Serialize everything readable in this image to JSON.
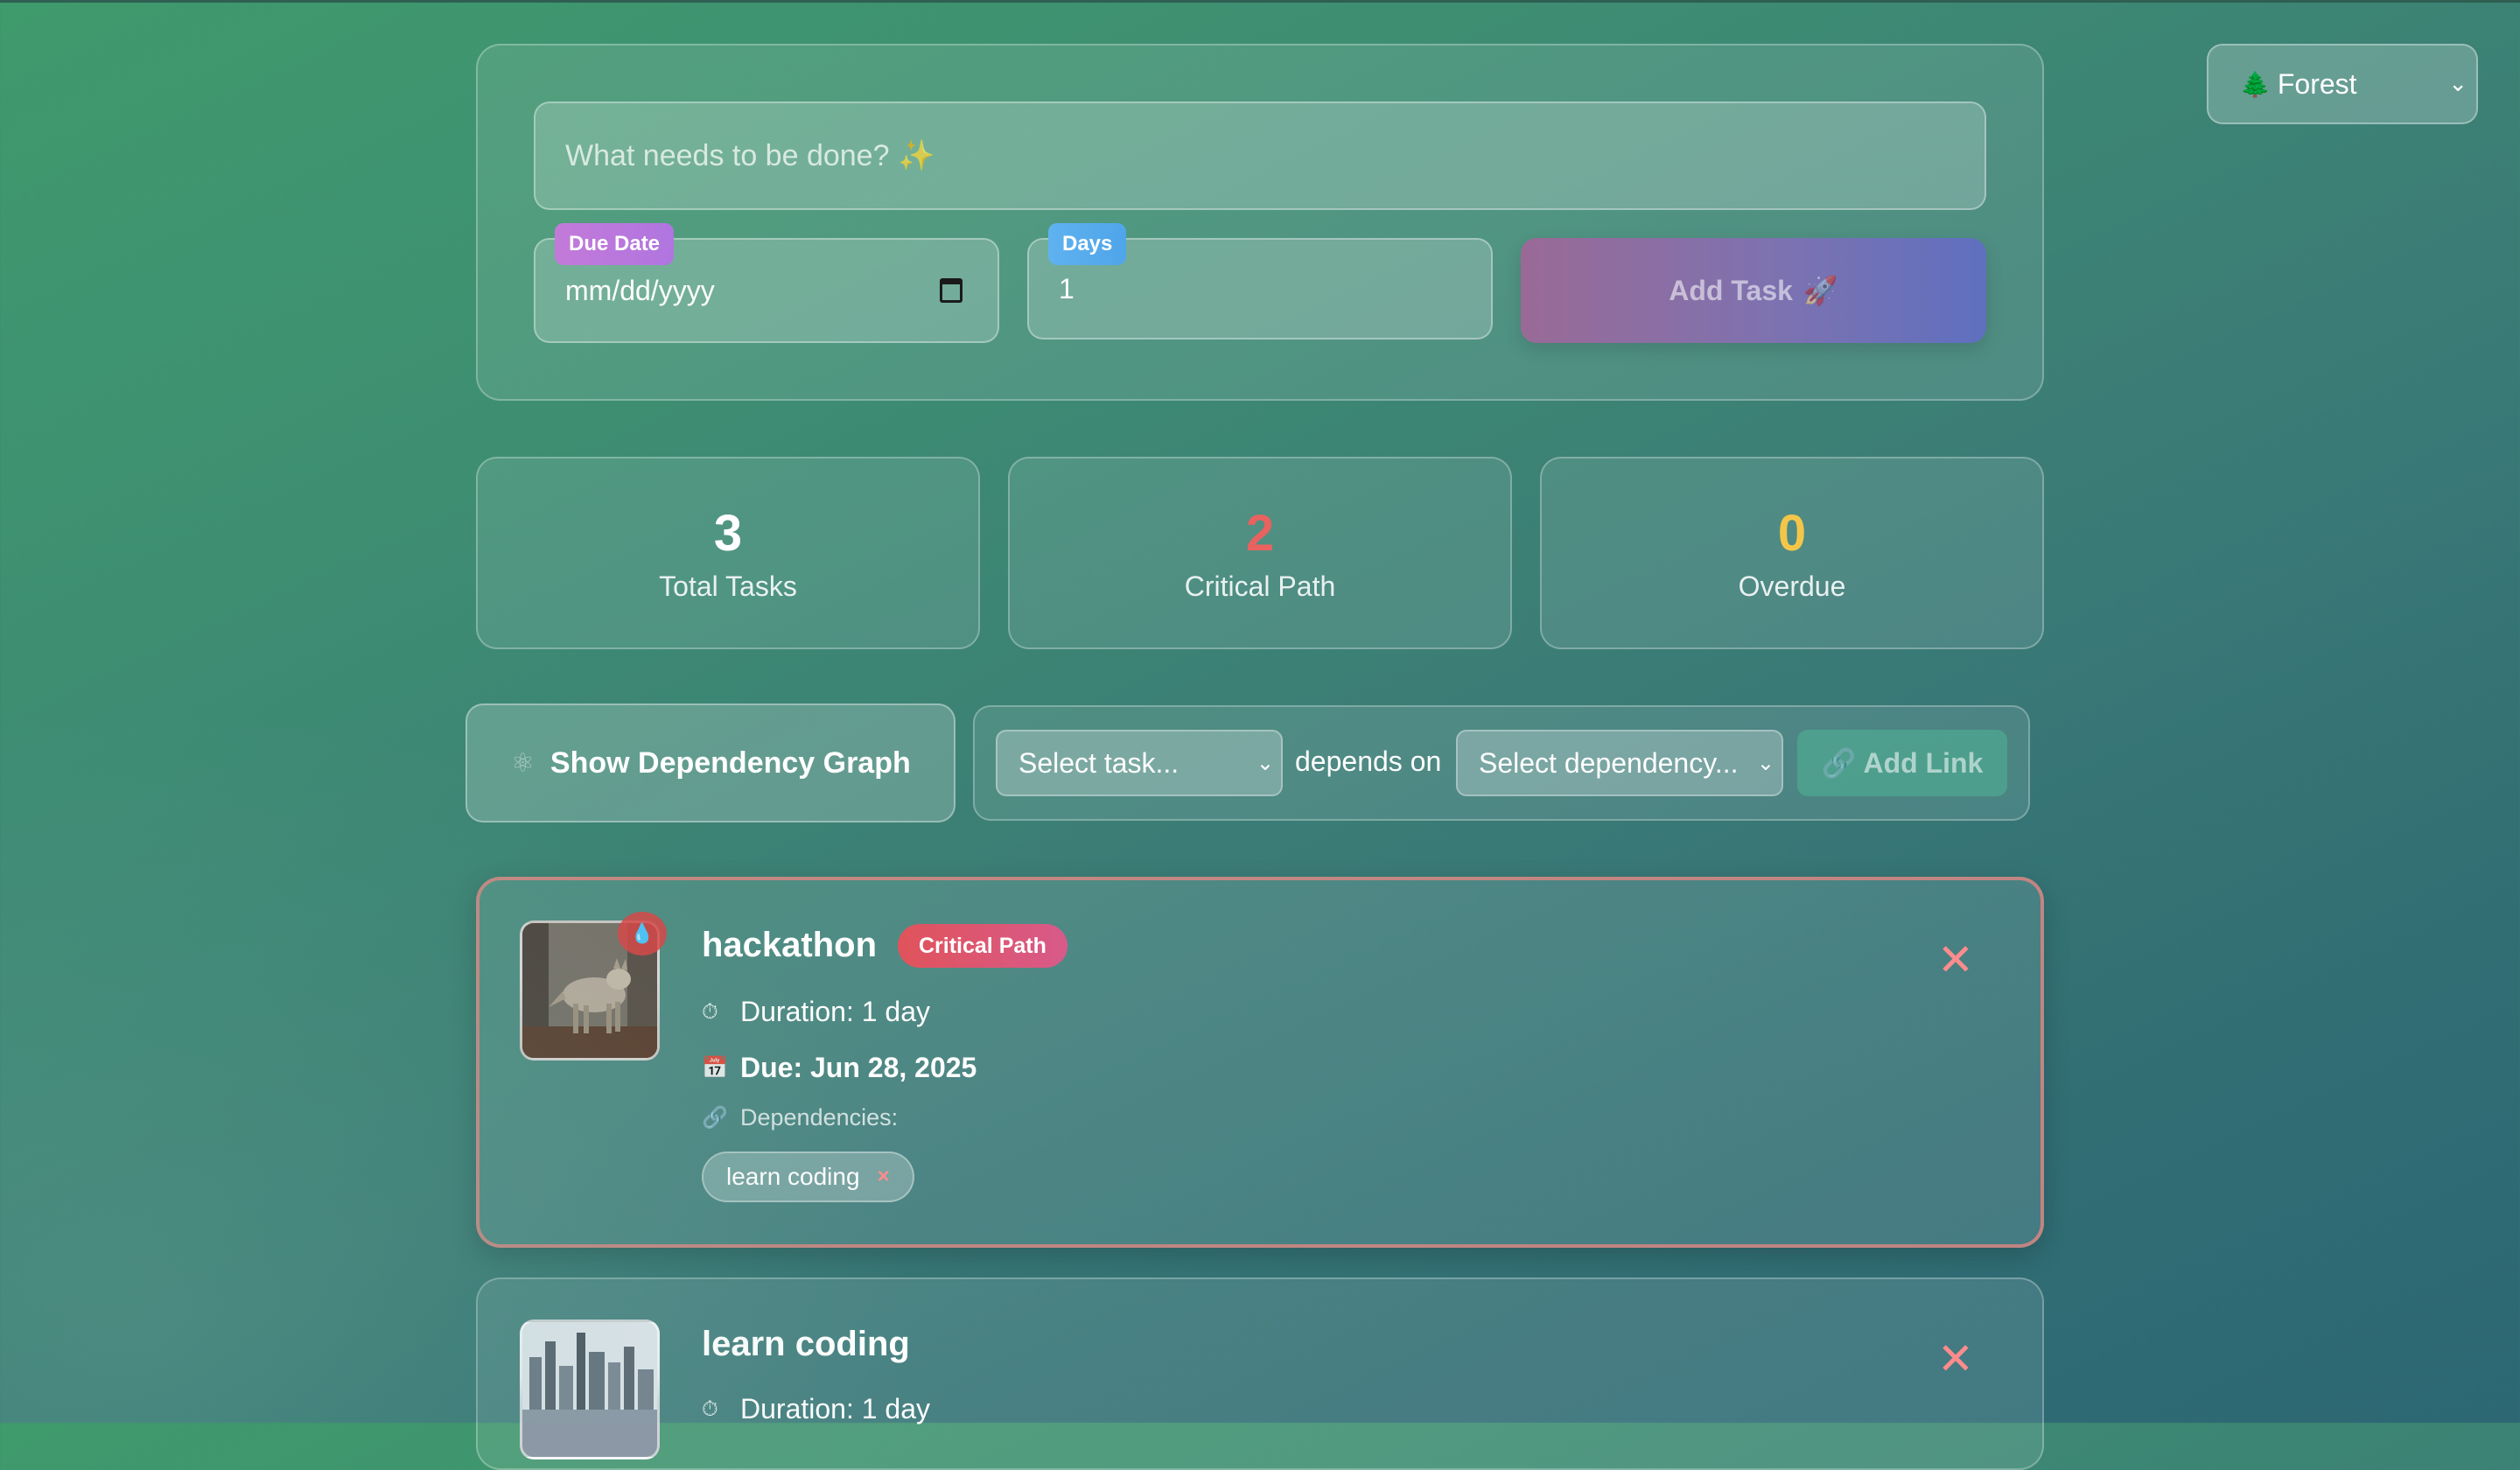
{
  "theme": {
    "selected": "Forest",
    "icon": "tree-icon"
  },
  "form": {
    "task_placeholder": "What needs to be done? ✨",
    "due_date_label": "Due Date",
    "due_date_placeholder": "mm/dd/yyyy",
    "days_label": "Days",
    "days_value": "1",
    "add_task_label": "Add Task",
    "add_task_icon": "🚀"
  },
  "stats": [
    {
      "value": "3",
      "label": "Total Tasks",
      "color": "#ffffff"
    },
    {
      "value": "2",
      "label": "Critical Path",
      "color": "#e8625f"
    },
    {
      "value": "0",
      "label": "Overdue",
      "color": "#f3c64a"
    }
  ],
  "dependency": {
    "graph_button_label": "Show Dependency Graph",
    "graph_icon": "⚛",
    "task_select_placeholder": "Select task...",
    "depends_on_text": "depends on",
    "dependency_select_placeholder": "Select dependency...",
    "add_link_label": "Add Link",
    "add_link_icon": "🔗"
  },
  "tasks": [
    {
      "title": "hackathon",
      "critical_badge": "Critical Path",
      "duration": "Duration: 1 day",
      "due": "Due: Jun 28, 2025",
      "dependencies_label": "Dependencies:",
      "dependencies": [
        "learn coding"
      ],
      "close": "✕",
      "fire_icon": "💧"
    },
    {
      "title": "learn coding",
      "duration": "Duration: 1 day",
      "close": "✕"
    }
  ],
  "icons": {
    "duration": "⏱",
    "due": "📅",
    "deps": "🔗",
    "remove": "×",
    "chevron": "⌄"
  },
  "colors": {
    "critical": "#e0535b",
    "overdue": "#f3c64a",
    "remove": "#ff8c8c"
  }
}
